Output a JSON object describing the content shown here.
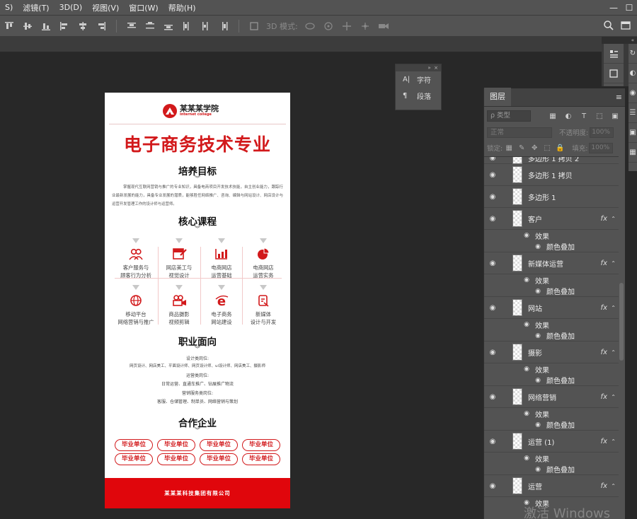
{
  "menubar": {
    "items": [
      "S)",
      "滤镜(T)",
      "3D(D)",
      "视图(V)",
      "窗口(W)",
      "帮助(H)"
    ],
    "window_controls": [
      "—",
      "☐"
    ]
  },
  "options_bar": {
    "mode_3d_label": "3D 模式:",
    "icons": [
      "align-top-edges-icon",
      "align-vertical-centers-icon",
      "align-bottom-edges-icon",
      "align-left-edges-icon",
      "align-horizontal-centers-icon",
      "align-right-edges-icon",
      "distribute-top-icon",
      "distribute-vertical-centers-icon",
      "distribute-bottom-icon",
      "distribute-left-icon",
      "distribute-horizontal-centers-icon",
      "distribute-right-icon",
      "auto-align-icon"
    ]
  },
  "char_panel": {
    "collapse": "»",
    "close": "×",
    "items": [
      {
        "icon": "A|",
        "label": "字符"
      },
      {
        "icon": "¶",
        "label": "段落"
      }
    ]
  },
  "document": {
    "logo_name": "某某某学院",
    "logo_sub": "Internet college",
    "logo_mark": "ⓐ",
    "title": "电子商务技术专业",
    "sections": {
      "goal_title": "培养目标",
      "goal_text": "掌握现代互联网营销与推广的专业知识，具备电商项目开发技术技能，自主创业能力，跟踪行业最新发展的能力，具备专业发展的潜质，能够胜任网络推广、咨询、编辑与网站设计、网店设计与运营开发管理工作的设计师与运营师。",
      "course_title": "核心课程",
      "career_title": "职业面向",
      "partner_title": "合作企业"
    },
    "chevron": "︾",
    "courses": [
      {
        "line1": "客户服务与",
        "line2": "顾客行为分析"
      },
      {
        "line1": "网店美工与",
        "line2": "视觉设计"
      },
      {
        "line1": "电商网店",
        "line2": "运营基础"
      },
      {
        "line1": "电商网店",
        "line2": "运营实务"
      },
      {
        "line1": "移动平台",
        "line2": "网络营销与推广"
      },
      {
        "line1": "商品摄影",
        "line2": "视频剪辑"
      },
      {
        "line1": "电子商务",
        "line2": "网站建设"
      },
      {
        "line1": "新媒体",
        "line2": "设计与开发"
      }
    ],
    "career_lines": [
      "设计类岗位:",
      "网页设计、网店美工、平面设计师、网页设计师、ui设计师、网店美工、摄影师",
      "运营类岗位:",
      "日常运营、直通车推广、钻展推广物流",
      "营销服务类岗位:",
      "客服、仓储管理、制单员、网络营销与策划"
    ],
    "partners": [
      "毕业单位",
      "毕业单位",
      "毕业单位",
      "毕业单位",
      "毕业单位",
      "毕业单位",
      "毕业单位",
      "毕业单位"
    ],
    "footer": "某某某科技集团有限公司"
  },
  "layers_panel": {
    "tab": "图层",
    "menu_icon": "≡",
    "kind_label": "ρ 类型",
    "blend_mode": "正常",
    "opacity_label": "不透明度:",
    "opacity_value": "100%",
    "lock_label": "锁定:",
    "fill_label": "填充:",
    "fill_value": "100%",
    "layers": [
      {
        "name": "多边形 1 拷贝 2",
        "fx": false,
        "effects": []
      },
      {
        "name": "多边形 1 拷贝",
        "fx": false,
        "effects": []
      },
      {
        "name": "多边形 1",
        "fx": false,
        "effects": []
      },
      {
        "name": "客户",
        "fx": true,
        "effects": [
          "效果",
          "颜色叠加"
        ]
      },
      {
        "name": "新媒体运营",
        "fx": true,
        "effects": [
          "效果",
          "颜色叠加"
        ]
      },
      {
        "name": "网站",
        "fx": true,
        "effects": [
          "效果",
          "颜色叠加"
        ]
      },
      {
        "name": "摄影",
        "fx": true,
        "effects": [
          "效果",
          "颜色叠加"
        ]
      },
      {
        "name": "网络营销",
        "fx": true,
        "effects": [
          "效果",
          "颜色叠加"
        ]
      },
      {
        "name": "运营 (1)",
        "fx": true,
        "effects": [
          "效果",
          "颜色叠加"
        ]
      },
      {
        "name": "运营",
        "fx": true,
        "effects": [
          "效果"
        ]
      }
    ]
  },
  "watermark": "激活 Windows",
  "colors": {
    "accent_red": "#d2191b",
    "footer_red": "#e0060c",
    "ui_panel": "#535353",
    "workspace": "#282828"
  }
}
